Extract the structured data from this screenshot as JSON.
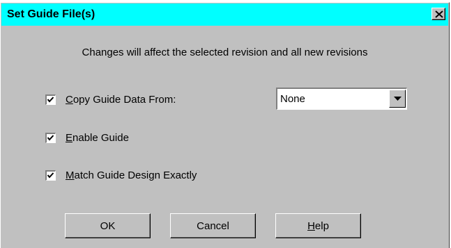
{
  "dialog": {
    "title": "Set Guide File(s)",
    "info_text": "Changes will affect the selected revision and all new revisions"
  },
  "options": {
    "copy": {
      "checked": true,
      "accel": "C",
      "rest": "opy Guide Data From:"
    },
    "enable": {
      "checked": true,
      "accel": "E",
      "rest": "nable Guide"
    },
    "match": {
      "checked": true,
      "accel": "M",
      "rest": "atch Guide Design Exactly"
    }
  },
  "source_select": {
    "value": "None"
  },
  "buttons": {
    "ok": "OK",
    "cancel": "Cancel",
    "help_accel": "H",
    "help_rest": "elp"
  },
  "icons": [
    "close-icon",
    "checkmark-icon",
    "dropdown-arrow-icon"
  ],
  "colors": {
    "titlebar": "#00ffff",
    "face": "#c0c0c0"
  }
}
